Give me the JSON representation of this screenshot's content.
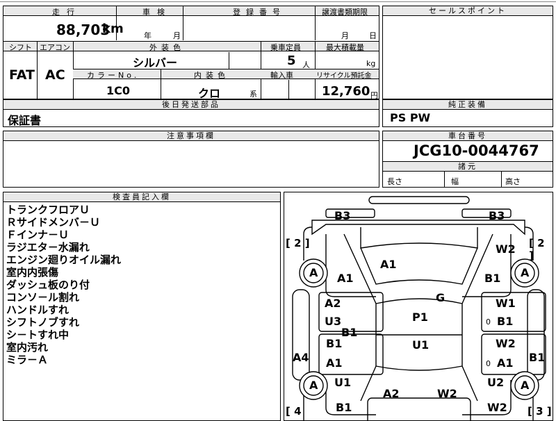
{
  "top": {
    "mileage_label": "走行",
    "mileage_value": "88,703",
    "mileage_unit": "km",
    "inspection_label": "車検",
    "year": "年",
    "month": "月",
    "registration_label": "登録番号",
    "transfer_label": "譲渡書類期限",
    "transfer_month": "月",
    "transfer_day": "日",
    "shift_label": "シフト",
    "shift_value": "FAT",
    "aircon_label": "エアコン",
    "aircon_value": "AC",
    "exterior_color_label": "外装色",
    "exterior_color_value": "シルバー",
    "capacity_label": "乗車定員",
    "capacity_value": "5",
    "capacity_unit": "人",
    "max_load_label": "最大積載量",
    "max_load_unit": "kg",
    "color_no_label": "カラーNo.",
    "color_no_value": "1C0",
    "interior_label": "内装色",
    "interior_value": "クロ",
    "interior_unit": "系",
    "import_label": "輸入車",
    "recycle_label": "リサイクル預託金",
    "recycle_value": "12,760",
    "recycle_unit": "円"
  },
  "sales_point": {
    "header": "セールスポイント"
  },
  "post_parts": {
    "header": "後日発送部品",
    "value": "保証書"
  },
  "genuine_equipment": {
    "header": "純正装備",
    "value": "PS PW"
  },
  "caution": {
    "header": "注意事項欄"
  },
  "chassis": {
    "header": "車台番号",
    "value": "JCG10-0044767"
  },
  "dimensions": {
    "header": "諸元",
    "length": "長さ",
    "width": "幅",
    "height": "高さ"
  },
  "inspector": {
    "header": "検査員記入欄",
    "notes": [
      "トランクフロアＵ",
      "Ｒサイドメンバ－Ｕ",
      "Ｆインナ－Ｕ",
      "ラジエタ－水漏れ",
      "エンジン廻りオイル漏れ",
      "室内内張傷",
      "ダッシュ板のり付",
      "コンソ－ル割れ",
      "ハンドルすれ",
      "シフトノブすれ",
      "シ－トすれ中",
      "室内汚れ",
      "ミラ－Ａ"
    ]
  },
  "diagram": {
    "tires": {
      "fl": "A",
      "fr": "A",
      "rl": "A",
      "rr": "A"
    },
    "tire_marks": {
      "fl": "2",
      "fr": "2",
      "rl": "4",
      "rr": "3"
    },
    "labels": {
      "b3_left": "B3",
      "b3_right": "B3",
      "w2_front": "W2",
      "a1_hood": "A1",
      "a1_front_left": "A1",
      "b1_front_right": "B1",
      "g_glass": "G",
      "p1_roof": "P1",
      "u1_center": "U1",
      "a2_left_door": "A2",
      "u3_left_door": "U3",
      "b1_left_pillar": "B1",
      "w1_right_door": "W1",
      "b1_right_door": "B1",
      "b1_left_rear_door": "B1",
      "a1_left_rear_door": "A1",
      "w2_right_rear_door": "W2",
      "a1_right_rear_door": "A1",
      "a4_left_rocker": "A4",
      "b1_right_rocker": "B1",
      "u1_rear_left": "U1",
      "u2_rear_right": "U2",
      "a2_trunk": "A2",
      "w2_trunk": "W2",
      "b1_rear_bumper": "B1",
      "w2_rear_bumper": "W2",
      "sub_0_a": "0",
      "sub_0_b": "0"
    }
  }
}
